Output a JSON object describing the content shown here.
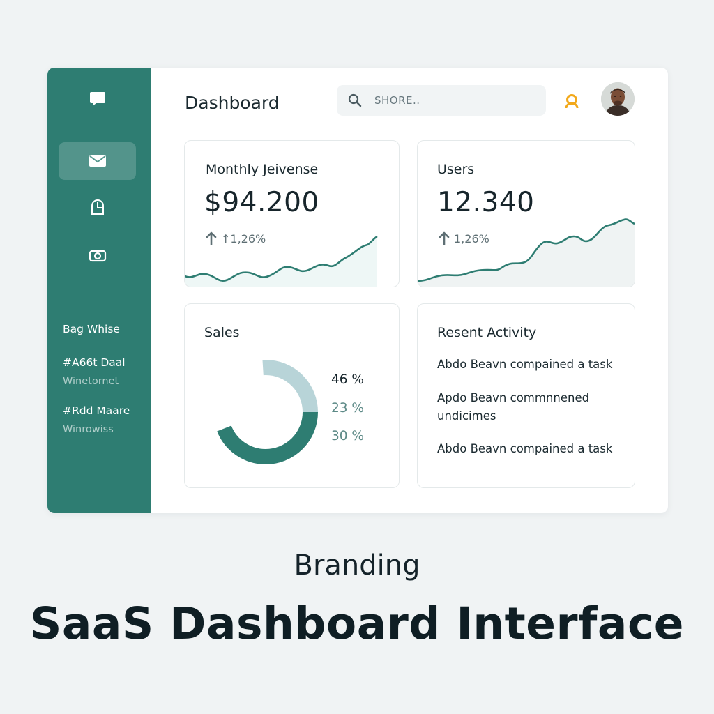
{
  "sidebar": {
    "icons": [
      "chat-icon",
      "mail-icon",
      "chart-icon",
      "money-icon"
    ],
    "items": [
      {
        "label": "Bag Whise"
      },
      {
        "label": "#A66t Daal",
        "sub": "Winetornet"
      },
      {
        "label": "#Rdd Maare",
        "sub": "Winrowiss"
      }
    ]
  },
  "header": {
    "title": "Dashboard",
    "search_placeholder": "SHORE..",
    "notification_icon": "user-icon",
    "avatar": "avatar"
  },
  "cards": {
    "revenue": {
      "title": "Monthly Jeivense",
      "value": "$94.200",
      "change": "↑1,26%"
    },
    "users": {
      "title": "Users",
      "value": "12.340",
      "change": "1,26%"
    },
    "sales": {
      "title": "Sales",
      "legend": [
        "46 %",
        "23 %",
        "30 %"
      ],
      "segments": [
        0.3,
        0.7
      ]
    },
    "activity": {
      "title": "Resent Activity",
      "items": [
        "Abdo Beavn compained a task",
        "Apdo Beavn commnnened undicimes",
        "Abdo Beavn compained a task"
      ]
    }
  },
  "caption": {
    "subtitle": "Branding",
    "title": "SaaS Dashboard Interface"
  },
  "colors": {
    "accent": "#2e7d72",
    "accent_light": "#b8d4d8",
    "background": "#f0f3f4",
    "notification": "#f2a91c"
  }
}
